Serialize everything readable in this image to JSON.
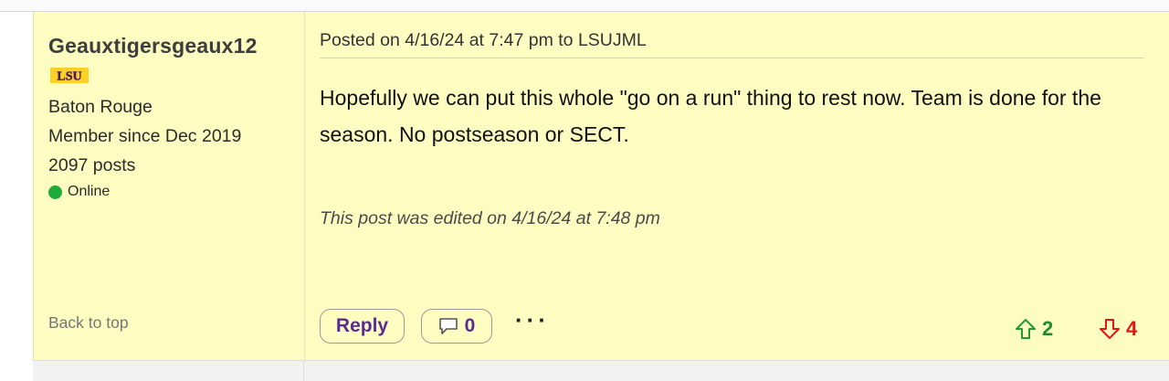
{
  "author": {
    "username": "Geauxtigersgeaux12",
    "team_logo_text": "LSU",
    "location": "Baton Rouge",
    "member_since": "Member since Dec 2019",
    "post_count": "2097 posts",
    "status": "Online",
    "status_color": "#1faa3c"
  },
  "sidebar": {
    "back_to_top": "Back to top"
  },
  "post": {
    "meta": "Posted on 4/16/24 at 7:47 pm to LSUJML",
    "body": "Hopefully we can put this whole \"go on a run\" thing to rest now. Team is done for the season. No postseason or SECT.",
    "edited_note": "This post was edited on 4/16/24 at 7:48 pm"
  },
  "actions": {
    "reply_label": "Reply",
    "comment_count": "0",
    "more_label": "···",
    "upvotes": "2",
    "downvotes": "4"
  },
  "colors": {
    "post_background": "#fdfdc2",
    "accent_purple": "#5a2b91",
    "upvote_green": "#1e8a2e",
    "downvote_red": "#e01515"
  },
  "icons": {
    "comment": "speech-bubble-icon",
    "upvote": "arrow-up-icon",
    "downvote": "arrow-down-icon",
    "team_logo": "lsu-logo-icon"
  }
}
